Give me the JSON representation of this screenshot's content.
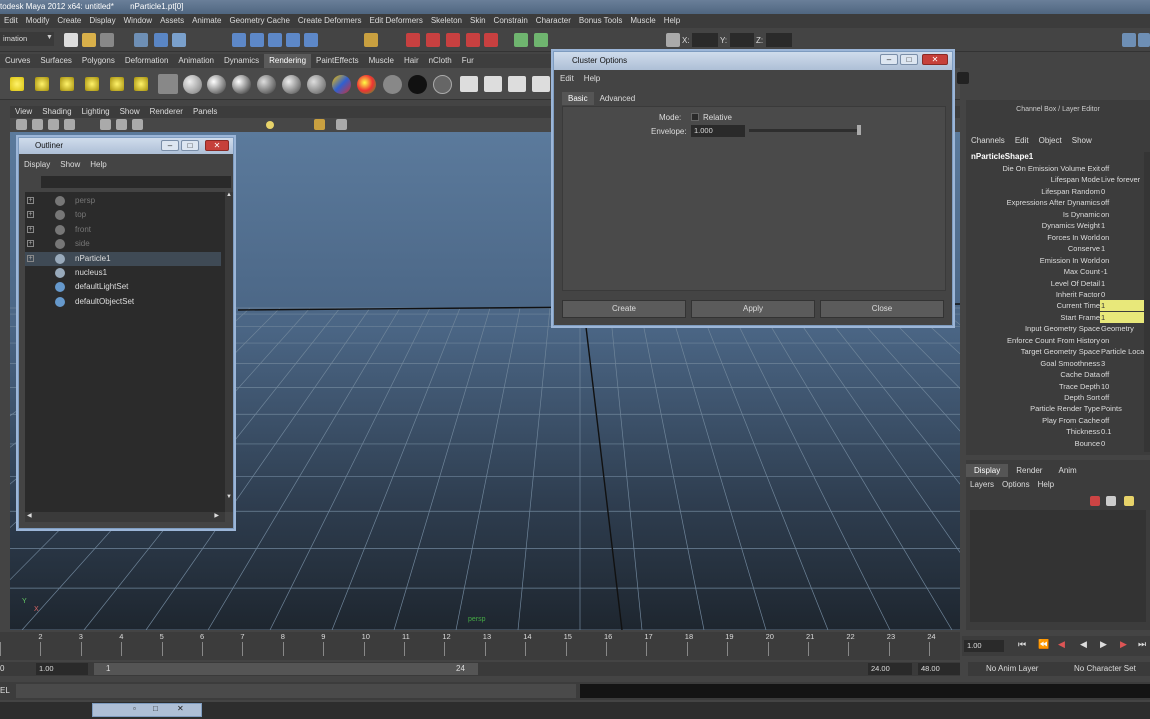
{
  "title": {
    "app": "todesk Maya 2012 x64: untitled*",
    "object": "nParticle1.pt[0]"
  },
  "menubar": [
    "Edit",
    "Modify",
    "Create",
    "Display",
    "Window",
    "Assets",
    "Animate",
    "Geometry Cache",
    "Create Deformers",
    "Edit Deformers",
    "Skeleton",
    "Skin",
    "Constrain",
    "Character",
    "Bonus Tools",
    "Muscle",
    "Help"
  ],
  "status": {
    "mode": "imation",
    "x_label": "X:",
    "y_label": "Y:",
    "z_label": "Z:"
  },
  "shelf_tabs": [
    "Curves",
    "Surfaces",
    "Polygons",
    "Deformation",
    "Animation",
    "Dynamics",
    "Rendering",
    "PaintEffects",
    "Muscle",
    "Hair",
    "nCloth",
    "Fur"
  ],
  "shelf_active": "Rendering",
  "panel_menu": [
    "View",
    "Shading",
    "Lighting",
    "Show",
    "Renderer",
    "Panels"
  ],
  "outliner": {
    "title": "Outliner",
    "menu": [
      "Display",
      "Show",
      "Help"
    ],
    "items": [
      {
        "label": "persp",
        "dim": true
      },
      {
        "label": "top",
        "dim": true
      },
      {
        "label": "front",
        "dim": true
      },
      {
        "label": "side",
        "dim": true
      },
      {
        "label": "nParticle1",
        "dim": false,
        "selected": true
      },
      {
        "label": "nucleus1",
        "dim": false
      },
      {
        "label": "defaultLightSet",
        "dim": false
      },
      {
        "label": "defaultObjectSet",
        "dim": false
      }
    ]
  },
  "cluster": {
    "title": "Cluster Options",
    "menu": [
      "Edit",
      "Help"
    ],
    "tabs": [
      "Basic",
      "Advanced"
    ],
    "mode_label": "Mode:",
    "mode_value": "Relative",
    "envelope_label": "Envelope:",
    "envelope_value": "1.000",
    "buttons": [
      "Create",
      "Apply",
      "Close"
    ]
  },
  "channel_box": {
    "header": "Channel Box / Layer Editor",
    "menu": [
      "Channels",
      "Edit",
      "Object",
      "Show"
    ],
    "node": "nParticleShape1",
    "attrs": [
      {
        "n": "Die On Emission Volume Exit",
        "v": "off"
      },
      {
        "n": "Lifespan Mode",
        "v": "Live forever"
      },
      {
        "n": "Lifespan Random",
        "v": "0"
      },
      {
        "n": "Expressions After Dynamics",
        "v": "off"
      },
      {
        "n": "Is Dynamic",
        "v": "on"
      },
      {
        "n": "Dynamics Weight",
        "v": "1"
      },
      {
        "n": "Forces In World",
        "v": "on"
      },
      {
        "n": "Conserve",
        "v": "1"
      },
      {
        "n": "Emission In World",
        "v": "on"
      },
      {
        "n": "Max Count",
        "v": "-1"
      },
      {
        "n": "Level Of Detail",
        "v": "1"
      },
      {
        "n": "Inherit Factor",
        "v": "0"
      },
      {
        "n": "Current Time",
        "v": "1",
        "hl": true
      },
      {
        "n": "Start Frame",
        "v": "1",
        "hl": true
      },
      {
        "n": "Input Geometry Space",
        "v": "Geometry"
      },
      {
        "n": "Enforce Count From History",
        "v": "on"
      },
      {
        "n": "Target Geometry Space",
        "v": "Particle Local"
      },
      {
        "n": "Goal Smoothness",
        "v": "3"
      },
      {
        "n": "Cache Data",
        "v": "off"
      },
      {
        "n": "Trace Depth",
        "v": "10"
      },
      {
        "n": "Depth Sort",
        "v": "off"
      },
      {
        "n": "Particle Render Type",
        "v": "Points"
      },
      {
        "n": "Play From Cache",
        "v": "off"
      },
      {
        "n": "Thickness",
        "v": "0.1"
      },
      {
        "n": "Bounce",
        "v": "0"
      }
    ]
  },
  "layer_editor": {
    "tabs": [
      "Display",
      "Render",
      "Anim"
    ],
    "menu": [
      "Layers",
      "Options",
      "Help"
    ]
  },
  "viewport": {
    "camera_label": "persp",
    "axis_y": "Y",
    "axis_x": "X"
  },
  "timeline": {
    "ticks": [
      "1",
      "2",
      "3",
      "4",
      "5",
      "6",
      "7",
      "8",
      "9",
      "10",
      "11",
      "12",
      "13",
      "14",
      "15",
      "16",
      "17",
      "18",
      "19",
      "20",
      "21",
      "22",
      "23",
      "24"
    ],
    "current_frame": "1.00",
    "range_start_outer": "1.00",
    "range_start": "1",
    "range_end": "24",
    "range_end_field": "24.00",
    "range_end_outer": "48.00",
    "anim_layer": "No Anim Layer",
    "character_set": "No Character Set",
    "left_field": "0",
    "cmd_label": "EL"
  }
}
